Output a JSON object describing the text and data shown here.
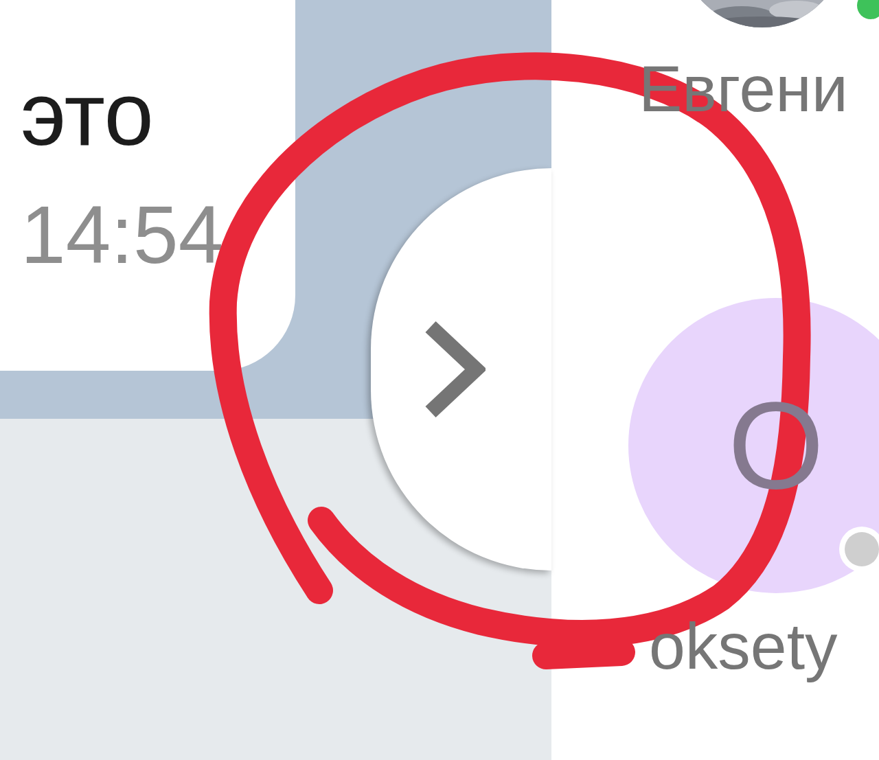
{
  "message": {
    "text": "это",
    "time": "14:54"
  },
  "contacts": [
    {
      "name": "Евгени",
      "color": "#3ec25a"
    },
    {
      "name": "oksety",
      "avatar": {
        "kind": "initial",
        "initial": "O"
      },
      "color": "#cfcfcf"
    }
  ],
  "annotation": {
    "kind": "freehand-circle"
  }
}
